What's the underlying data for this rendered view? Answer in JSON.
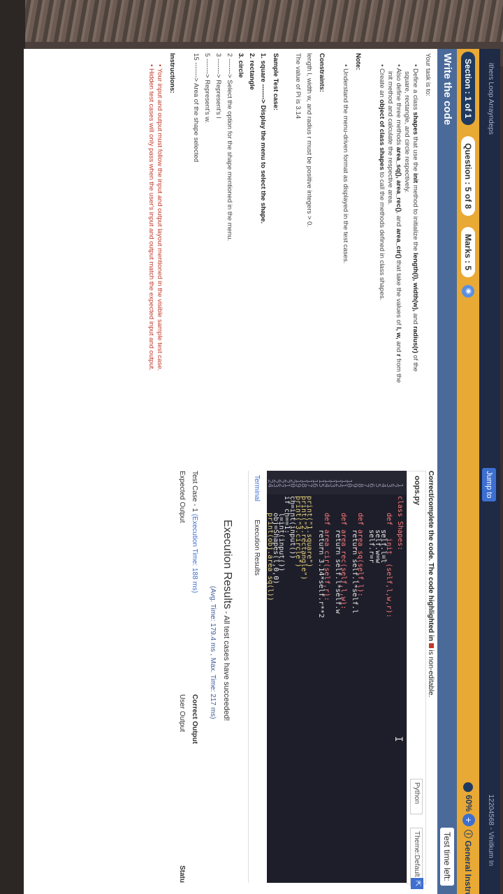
{
  "header": {
    "top_left_text": "ithers Loop Arrayndeps",
    "jump_to": "Jump to",
    "top_right_id": "12204568 - Vinitkum In"
  },
  "tabs": {
    "section": "Section : 1 of 1",
    "question": "Question : 5 of 8",
    "marks": "Marks : 5",
    "progress": "60%",
    "general": "General Instructio"
  },
  "title_bar": {
    "title": "Write the code",
    "test_time": "Test time left:"
  },
  "problem": {
    "task_intro": "Your task is to:",
    "bullet1_a": "Define a class ",
    "bullet1_b": "shapes",
    "bullet1_c": " that use the ",
    "bullet1_d": "init",
    "bullet1_e": " method to initialize the ",
    "bullet1_f": "length(l), width(w),",
    "bullet1_g": " and ",
    "bullet1_h": "radius(r)",
    "bullet1_i": " of the",
    "bullet1_line2": "square, rectangle, and circle respectively.",
    "bullet2_a": "Also define three methods ",
    "bullet2_b": "area_sq(), area_rec()",
    "bullet2_c": ", and ",
    "bullet2_d": "area_cir()",
    "bullet2_e": " that take the values of ",
    "bullet2_f": "l, w,",
    "bullet2_g": " and ",
    "bullet2_h": "r",
    "bullet2_i": " from the",
    "bullet2_line2": "init method and calculate the respective area.",
    "bullet3_a": "Create an ",
    "bullet3_b": "object of class shapes",
    "bullet3_c": " to call the methods defined in class shapes.",
    "note_label": "Note:",
    "note_bullet": "Understand the menu-driven format as displayed in the test cases.",
    "constraints_label": "Constraints:",
    "constraint1": "length l, width w, and radius r must be positive integers > 0.",
    "constraint2": "The value of Pi is 3.14",
    "sample_label": "Sample Test case:",
    "sample1": "1. square -------> Display the menu to select the shape.",
    "sample2": "2. rectangle",
    "sample3": "3. circle",
    "sample4": "2 -------> Select the option for the shape mentioned in the menu.",
    "sample5": "3 -------> Represent's l",
    "sample6": "5 -------> Represent's w.",
    "sample7": "15 -------> Area of the shape selected",
    "instructions_label": "Instructions:",
    "instruction1": "Your input and output must follow the input and output layout mentioned in the visible sample test case.",
    "instruction2": "Hidden test cases will only pass when the user's input and output match the expected input and output."
  },
  "editor": {
    "note_a": "Correct/complete the code. The code highlighted in ",
    "note_b": " is non-editable.",
    "filename": "oops.py",
    "language": "Python",
    "theme": "Theme:Default",
    "close": "x",
    "lines": [
      {
        "n": "1",
        "code": "class Shapes:"
      },
      {
        "n": "2",
        "code": ""
      },
      {
        "n": "3",
        "code": "    def __init__(self,l,w,r):"
      },
      {
        "n": "4",
        "code": "        self.l=l"
      },
      {
        "n": "5",
        "code": "        self.w=w"
      },
      {
        "n": "6",
        "code": "        self.r=r"
      },
      {
        "n": "7",
        "code": ""
      },
      {
        "n": "8",
        "code": "    def area_sq(self,l):"
      },
      {
        "n": "9",
        "code": "        return self.l*self.l"
      },
      {
        "n": "10",
        "code": ""
      },
      {
        "n": "11",
        "code": "    def area_rec(self,l,w):"
      },
      {
        "n": "12",
        "code": "        return self.l*self.w"
      },
      {
        "n": "13",
        "code": ""
      },
      {
        "n": "14",
        "code": "    def area_cir(self,r):"
      },
      {
        "n": "15",
        "code": "        return 3.14*self.r**2"
      },
      {
        "n": "16",
        "code": ""
      },
      {
        "n": "17",
        "code": "print(\"1.square\")"
      },
      {
        "n": "18",
        "code": "print(\"2.rectangle\")"
      },
      {
        "n": "19",
        "code": "print(\"3.circle\")"
      },
      {
        "n": "20",
        "code": "ch=int(input())"
      },
      {
        "n": "21",
        "code": "if ch==1:"
      },
      {
        "n": "22",
        "code": "    l=int(input())"
      },
      {
        "n": "23",
        "code": "    obj=Shapes(l,0,0)"
      },
      {
        "n": "24",
        "code": "    print(obj.area_sq(l))"
      }
    ]
  },
  "results": {
    "tab_terminal": "Terminal",
    "tab_results": "Execution Results",
    "title": "Execution Results",
    "title_suffix": " - All test cases have succeeded!",
    "avg": "(Avg. Time: 179.4 ms , Max. Time: 217 ms)",
    "test_case": "Test Case - 1 ",
    "test_time": "(Execution Time: 188 ms)",
    "expected": "Expected Output",
    "correct": "Correct Output",
    "user": "User Output",
    "status": "Statu"
  }
}
